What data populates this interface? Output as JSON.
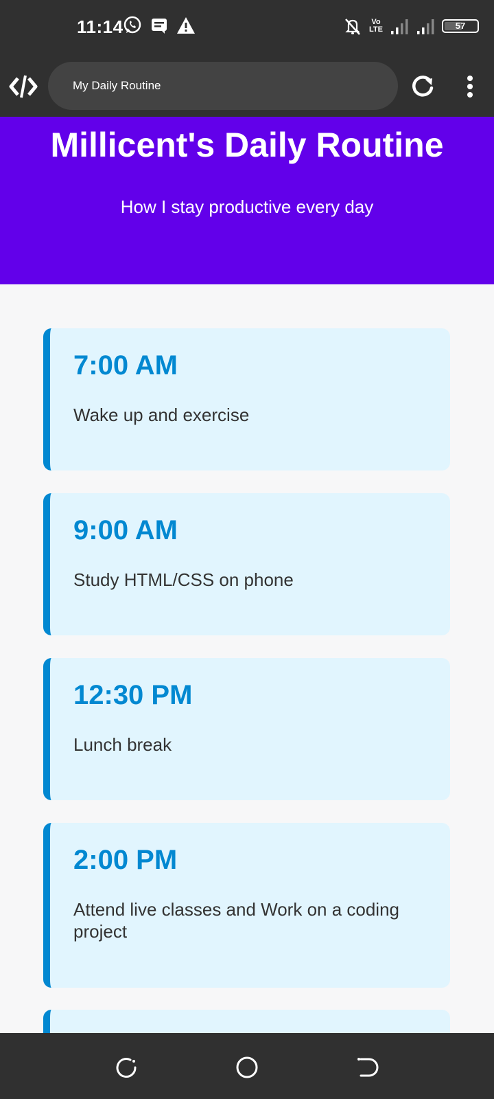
{
  "status_bar": {
    "time": "11:14",
    "battery": "57",
    "volte": [
      "Vo",
      "LTE"
    ]
  },
  "browser": {
    "url_title": "My Daily Routine",
    "icons": [
      "app-logo-icon",
      "reload-icon",
      "more-vert-icon"
    ]
  },
  "hero": {
    "title": "Millicent's Daily Routine",
    "subtitle": "How I stay productive every day",
    "bg_color": "#6200ea"
  },
  "routine": [
    {
      "time": "7:00 AM",
      "activity": "Wake up and exercise"
    },
    {
      "time": "9:00 AM",
      "activity": "Study HTML/CSS on phone"
    },
    {
      "time": "12:30 PM",
      "activity": "Lunch break"
    },
    {
      "time": "2:00 PM",
      "activity": "Attend live classes and Work on a coding project"
    }
  ],
  "colors": {
    "accent": "#0288d1",
    "card_bg": "#e1f5fe",
    "page_bg": "#f7f7f8",
    "chrome": "#303030"
  },
  "nav_bar": {
    "icons": [
      "recent-apps-icon",
      "home-icon",
      "back-icon"
    ]
  }
}
